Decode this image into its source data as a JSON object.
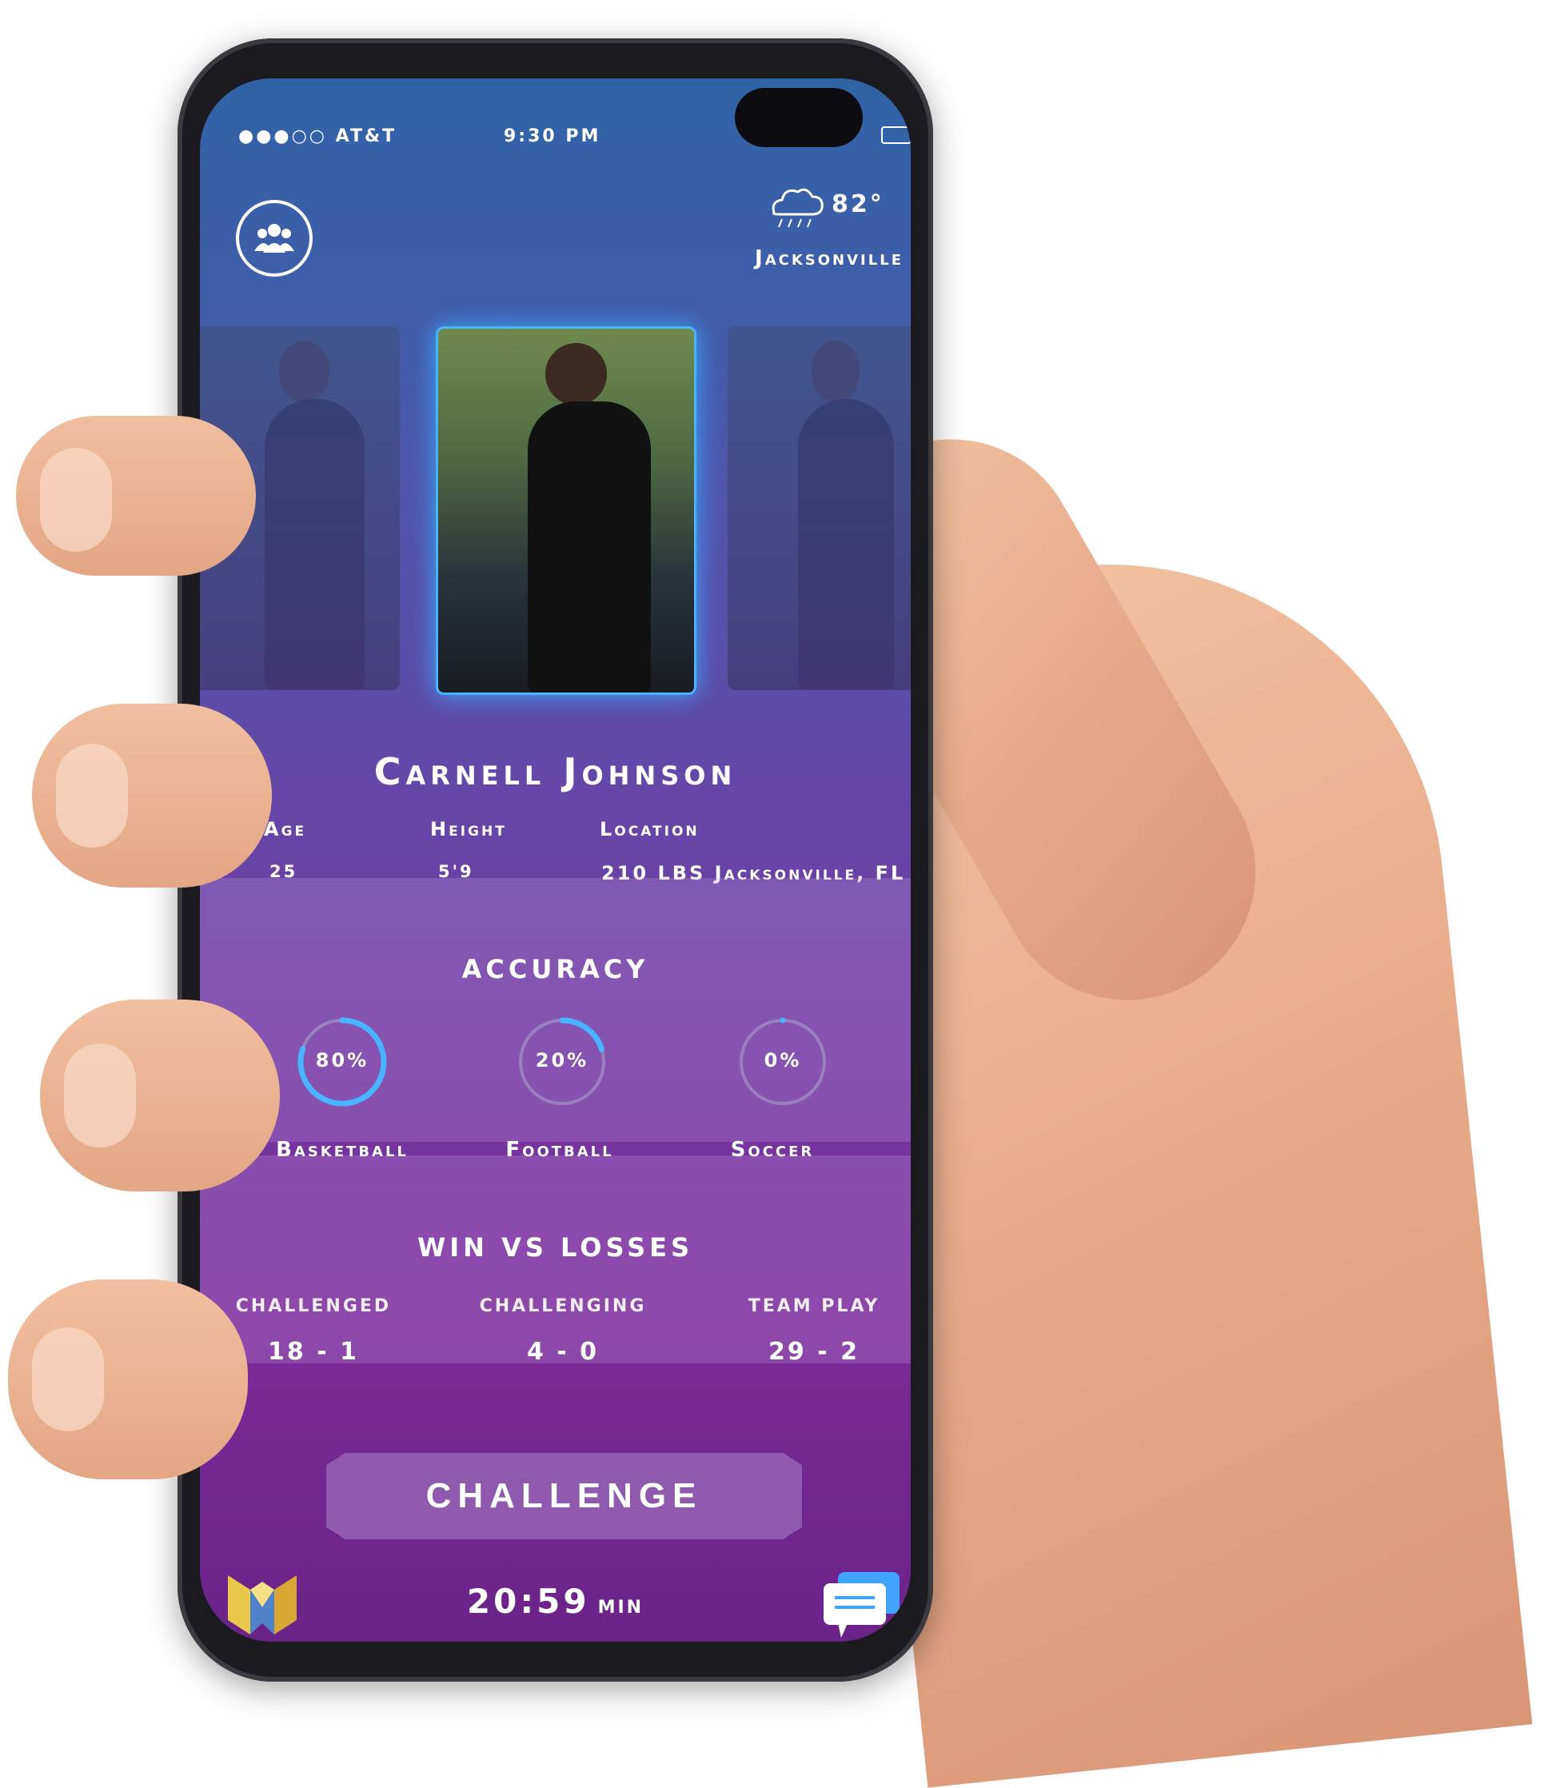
{
  "status_bar": {
    "carrier": "●●●○○ AT&T",
    "time": "9:30 PM"
  },
  "weather": {
    "temperature": "82°",
    "city": "Jacksonville"
  },
  "profile": {
    "name": "Carnell Johnson",
    "age_label": "Age",
    "age": "25",
    "height_label": "Height",
    "height": "5'9",
    "location_label": "Location",
    "weight_location": "210 LBS Jacksonville, FL"
  },
  "accuracy": {
    "title": "ACCURACY",
    "items": [
      {
        "sport": "Basketball",
        "percent_label": "80%",
        "value": 0.8
      },
      {
        "sport": "Football",
        "percent_label": "20%",
        "value": 0.2
      },
      {
        "sport": "Soccer",
        "percent_label": "0%",
        "value": 0.0
      }
    ]
  },
  "record": {
    "title": "WIN VS LOSSES",
    "items": [
      {
        "label": "CHALLENGED",
        "value": "18 - 1"
      },
      {
        "label": "CHALLENGING",
        "value": "4 - 0"
      },
      {
        "label": "TEAM PLAY",
        "value": "29 - 2"
      }
    ]
  },
  "actions": {
    "challenge_label": "CHALLENGE"
  },
  "timer": {
    "value": "20:59",
    "unit": "MIN"
  },
  "colors": {
    "accent_blue": "#49b4ff",
    "ring_track": "#a8a0c8",
    "button": "#8f5aae"
  },
  "icons": [
    "team-icon",
    "weather-rain-icon",
    "app-logo-icon",
    "chat-icon"
  ]
}
